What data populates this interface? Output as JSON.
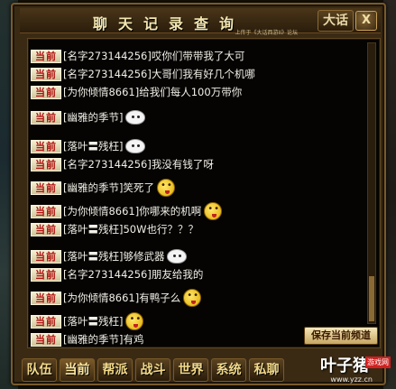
{
  "window": {
    "title": "聊天记录查询",
    "subtitle": "上传于《大话西游II》论坛",
    "close_label": "X",
    "logo_text": "大话"
  },
  "messages": [
    {
      "channel": "当前",
      "text": "[名字273144256]哎你们带带我了大可",
      "emoji": null
    },
    {
      "channel": "当前",
      "text": "[名字273144256]大哥们我有好几个机哪",
      "emoji": null
    },
    {
      "channel": "当前",
      "text": "[为你倾情8661]给我们每人100万带你",
      "emoji": null
    },
    {
      "channel": "当前",
      "text": "[幽雅的季节]",
      "emoji": "ghost-emoji"
    },
    {
      "channel": "当前",
      "text": "[落叶〓残枉]",
      "emoji": "ghost-emoji"
    },
    {
      "channel": "当前",
      "text": "[名字273144256]我没有钱了呀",
      "emoji": null
    },
    {
      "channel": "当前",
      "text": "[幽雅的季节]笑死了",
      "emoji": "face-emoji"
    },
    {
      "channel": "当前",
      "text": "[为你倾情8661]你哪来的机啊",
      "emoji": "face-emoji"
    },
    {
      "channel": "当前",
      "text": "[落叶〓残枉]50W也行？？？",
      "emoji": null
    },
    {
      "channel": "当前",
      "text": "[落叶〓残枉]够修武器",
      "emoji": "ghost-emoji"
    },
    {
      "channel": "当前",
      "text": "[名字273144256]朋友给我的",
      "emoji": null
    },
    {
      "channel": "当前",
      "text": "[为你倾情8661]有鸭子么",
      "emoji": "face-emoji"
    },
    {
      "channel": "当前",
      "text": "[落叶〓残枉]",
      "emoji": "face-emoji"
    },
    {
      "channel": "当前",
      "text": "[幽雅的季节]有鸡",
      "emoji": null
    }
  ],
  "save_button": "保存当前频道",
  "tabs": [
    "队伍",
    "当前",
    "帮派",
    "战斗",
    "世界",
    "系统",
    "私聊"
  ],
  "active_tab": "当前",
  "watermark": {
    "main": "叶子猪",
    "tag": "游戏网",
    "url": "www.yzz.cn"
  }
}
